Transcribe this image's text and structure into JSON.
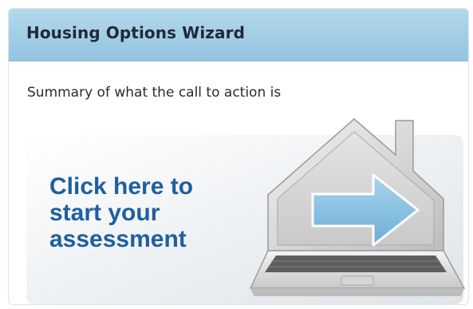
{
  "panel": {
    "title": "Housing Options Wizard",
    "summary": "Summary of what the call to action is"
  },
  "cta": {
    "line1": "Click here to",
    "line2": "start your",
    "line3": "assessment",
    "icon": "laptop-house-arrow-icon"
  },
  "colors": {
    "header": "#9fcbe3",
    "cta_text": "#1f5fa0",
    "arrow": "#8fc3e2"
  }
}
